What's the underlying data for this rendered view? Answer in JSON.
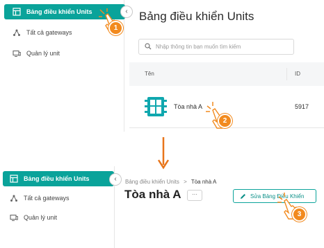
{
  "panel1": {
    "sidebar": {
      "items": [
        {
          "label": "Bảng điều khiển Units",
          "icon": "dashboard-icon",
          "active": true
        },
        {
          "label": "Tất cả gateways",
          "icon": "gateway-icon",
          "active": false
        },
        {
          "label": "Quản lý unit",
          "icon": "unit-icon",
          "active": false
        }
      ],
      "collapse_symbol": "‹"
    },
    "title": "Bảng điều khiển Units",
    "search": {
      "placeholder": "Nhập thông tin bạn muốn tìm kiếm"
    },
    "table": {
      "columns": [
        "Tên",
        "ID"
      ],
      "rows": [
        {
          "name": "Tòa nhà A",
          "id": "5917"
        }
      ]
    }
  },
  "panel2": {
    "sidebar": {
      "items": [
        {
          "label": "Bảng điều khiển Units",
          "icon": "dashboard-icon",
          "active": true
        },
        {
          "label": "Tất cả gateways",
          "icon": "gateway-icon",
          "active": false
        },
        {
          "label": "Quản lý unit",
          "icon": "unit-icon",
          "active": false
        }
      ],
      "collapse_symbol": "‹"
    },
    "breadcrumb": {
      "parent": "Bảng điều khiển Units",
      "separator": ">",
      "current": "Tòa nhà A"
    },
    "title": "Tòa nhà A",
    "more_label": "···",
    "edit_button": "Sửa Bảng Điều Khiển"
  },
  "steps": [
    "1",
    "2",
    "3"
  ],
  "colors": {
    "accent": "#0aa39a",
    "step": "#f28a1e",
    "arrow": "#e8751a"
  }
}
